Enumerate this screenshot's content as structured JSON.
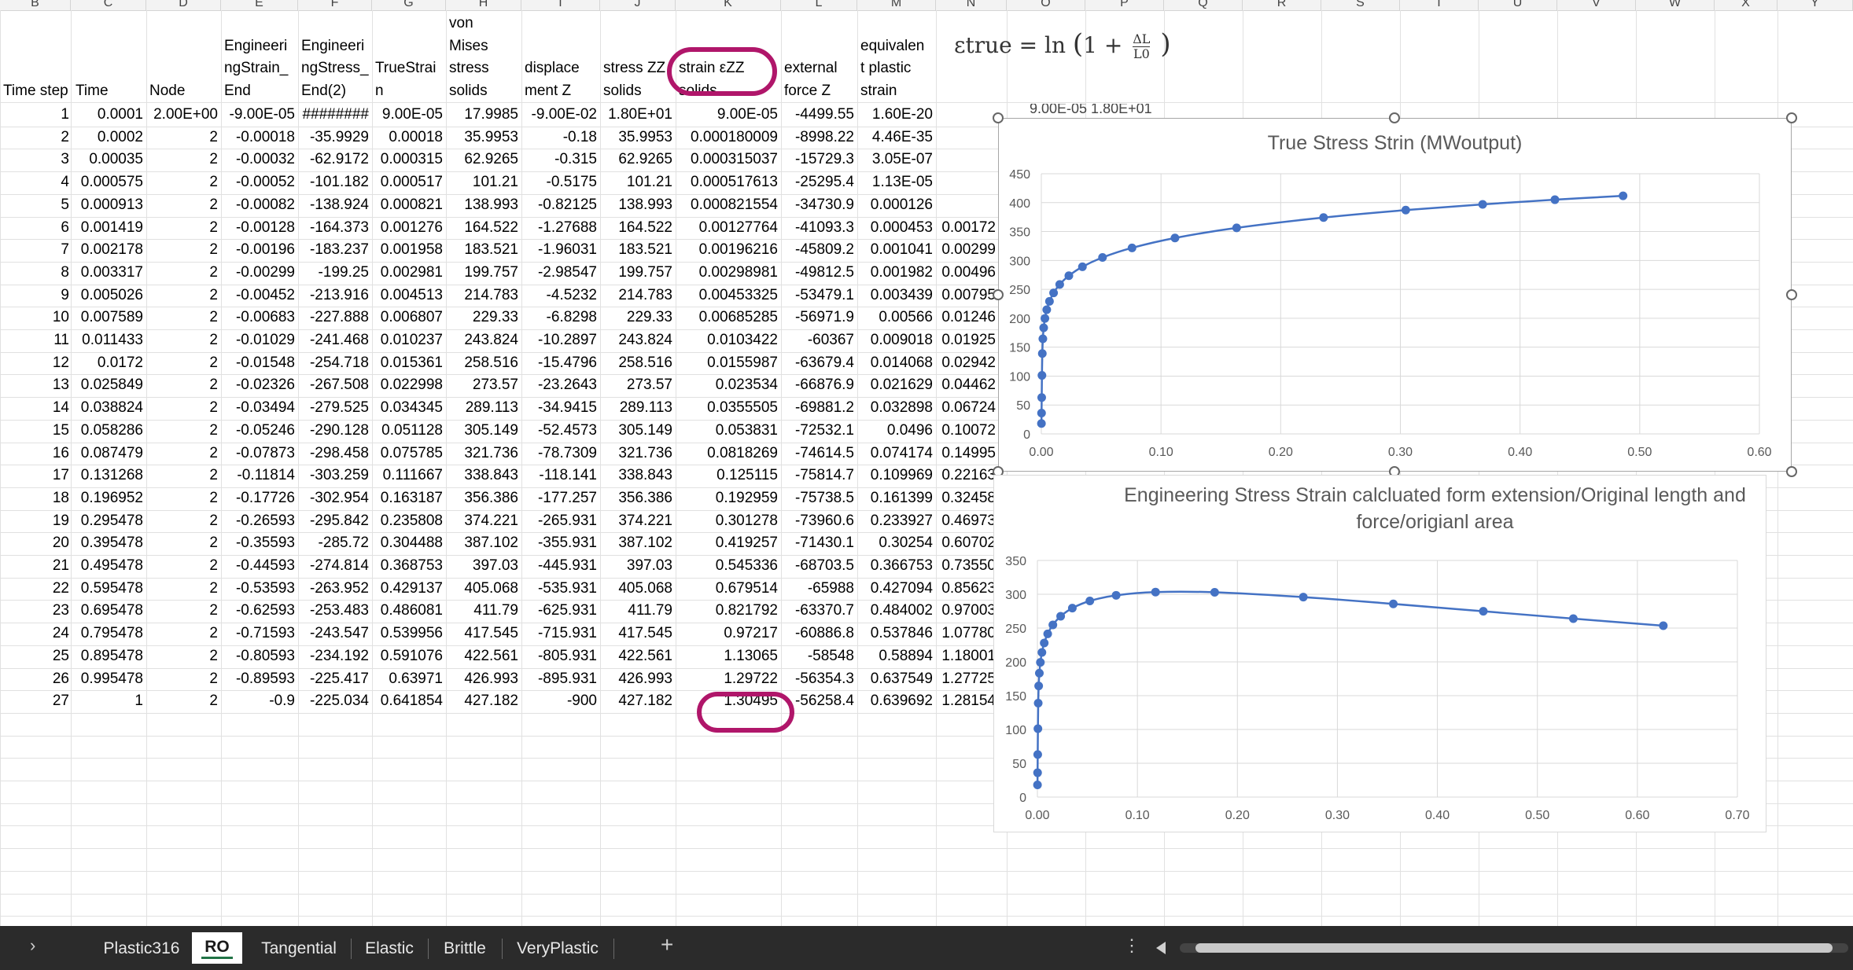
{
  "column_letters": [
    "B",
    "C",
    "D",
    "E",
    "F",
    "G",
    "H",
    "I",
    "J",
    "K",
    "L",
    "M",
    "N",
    "O",
    "P",
    "Q",
    "R",
    "S",
    "T",
    "U",
    "V",
    "W",
    "X",
    "Y"
  ],
  "headers": [
    "Time step",
    "Time",
    "Node",
    "Engineeri\nngStrain_\nEnd",
    "Engineeri\nngStress_\nEnd(2)",
    "TrueStrai\nn",
    "von\nMises\nstress\nsolids",
    "displace\nment Z",
    "stress ZZ\nsolids",
    "strain εZZ\nsolids",
    "external\nforce Z",
    "equivalen\nt plastic\nstrain"
  ],
  "rows": [
    [
      "1",
      "0.0001",
      "2.00E+00",
      "-9.00E-05",
      "########",
      "9.00E-05",
      "17.9985",
      "-9.00E-02",
      "1.80E+01",
      "9.00E-05",
      "-4499.55",
      "1.60E-20",
      ""
    ],
    [
      "2",
      "0.0002",
      "2",
      "-0.00018",
      "-35.9929",
      "0.00018",
      "35.9953",
      "-0.18",
      "35.9953",
      "0.000180009",
      "-8998.22",
      "4.46E-35",
      ""
    ],
    [
      "3",
      "0.00035",
      "2",
      "-0.00032",
      "-62.9172",
      "0.000315",
      "62.9265",
      "-0.315",
      "62.9265",
      "0.000315037",
      "-15729.3",
      "3.05E-07",
      ""
    ],
    [
      "4",
      "0.000575",
      "2",
      "-0.00052",
      "-101.182",
      "0.000517",
      "101.21",
      "-0.5175",
      "101.21",
      "0.000517613",
      "-25295.4",
      "1.13E-05",
      ""
    ],
    [
      "5",
      "0.000913",
      "2",
      "-0.00082",
      "-138.924",
      "0.000821",
      "138.993",
      "-0.82125",
      "138.993",
      "0.000821554",
      "-34730.9",
      "0.000126",
      ""
    ],
    [
      "6",
      "0.001419",
      "2",
      "-0.00128",
      "-164.373",
      "0.001276",
      "164.522",
      "-1.27688",
      "164.522",
      "0.00127764",
      "-41093.3",
      "0.000453",
      "0.00172"
    ],
    [
      "7",
      "0.002178",
      "2",
      "-0.00196",
      "-183.237",
      "0.001958",
      "183.521",
      "-1.96031",
      "183.521",
      "0.00196216",
      "-45809.2",
      "0.001041",
      "0.00299"
    ],
    [
      "8",
      "0.003317",
      "2",
      "-0.00299",
      "-199.25",
      "0.002981",
      "199.757",
      "-2.98547",
      "199.757",
      "0.00298981",
      "-49812.5",
      "0.001982",
      "0.00496"
    ],
    [
      "9",
      "0.005026",
      "2",
      "-0.00452",
      "-213.916",
      "0.004513",
      "214.783",
      "-4.5232",
      "214.783",
      "0.00453325",
      "-53479.1",
      "0.003439",
      "0.00795"
    ],
    [
      "10",
      "0.007589",
      "2",
      "-0.00683",
      "-227.888",
      "0.006807",
      "229.33",
      "-6.8298",
      "229.33",
      "0.00685285",
      "-56971.9",
      "0.00566",
      "0.01246"
    ],
    [
      "11",
      "0.011433",
      "2",
      "-0.01029",
      "-241.468",
      "0.010237",
      "243.824",
      "-10.2897",
      "243.824",
      "0.0103422",
      "-60367",
      "0.009018",
      "0.01925"
    ],
    [
      "12",
      "0.0172",
      "2",
      "-0.01548",
      "-254.718",
      "0.015361",
      "258.516",
      "-15.4796",
      "258.516",
      "0.0155987",
      "-63679.4",
      "0.014068",
      "0.02942"
    ],
    [
      "13",
      "0.025849",
      "2",
      "-0.02326",
      "-267.508",
      "0.022998",
      "273.57",
      "-23.2643",
      "273.57",
      "0.023534",
      "-66876.9",
      "0.021629",
      "0.04462"
    ],
    [
      "14",
      "0.038824",
      "2",
      "-0.03494",
      "-279.525",
      "0.034345",
      "289.113",
      "-34.9415",
      "289.113",
      "0.0355505",
      "-69881.2",
      "0.032898",
      "0.06724"
    ],
    [
      "15",
      "0.058286",
      "2",
      "-0.05246",
      "-290.128",
      "0.051128",
      "305.149",
      "-52.4573",
      "305.149",
      "0.053831",
      "-72532.1",
      "0.0496",
      "0.10072"
    ],
    [
      "16",
      "0.087479",
      "2",
      "-0.07873",
      "-298.458",
      "0.075785",
      "321.736",
      "-78.7309",
      "321.736",
      "0.0818269",
      "-74614.5",
      "0.074174",
      "0.14995"
    ],
    [
      "17",
      "0.131268",
      "2",
      "-0.11814",
      "-303.259",
      "0.111667",
      "338.843",
      "-118.141",
      "338.843",
      "0.125115",
      "-75814.7",
      "0.109969",
      "0.22163"
    ],
    [
      "18",
      "0.196952",
      "2",
      "-0.17726",
      "-302.954",
      "0.163187",
      "356.386",
      "-177.257",
      "356.386",
      "0.192959",
      "-75738.5",
      "0.161399",
      "0.32458"
    ],
    [
      "19",
      "0.295478",
      "2",
      "-0.26593",
      "-295.842",
      "0.235808",
      "374.221",
      "-265.931",
      "374.221",
      "0.301278",
      "-73960.6",
      "0.233927",
      "0.46973"
    ],
    [
      "20",
      "0.395478",
      "2",
      "-0.35593",
      "-285.72",
      "0.304488",
      "387.102",
      "-355.931",
      "387.102",
      "0.419257",
      "-71430.1",
      "0.30254",
      "0.60702"
    ],
    [
      "21",
      "0.495478",
      "2",
      "-0.44593",
      "-274.814",
      "0.368753",
      "397.03",
      "-445.931",
      "397.03",
      "0.545336",
      "-68703.5",
      "0.366753",
      "0.73550"
    ],
    [
      "22",
      "0.595478",
      "2",
      "-0.53593",
      "-263.952",
      "0.429137",
      "405.068",
      "-535.931",
      "405.068",
      "0.679514",
      "-65988",
      "0.427094",
      "0.85623"
    ],
    [
      "23",
      "0.695478",
      "2",
      "-0.62593",
      "-253.483",
      "0.486081",
      "411.79",
      "-625.931",
      "411.79",
      "0.821792",
      "-63370.7",
      "0.484002",
      "0.97003"
    ],
    [
      "24",
      "0.795478",
      "2",
      "-0.71593",
      "-243.547",
      "0.539956",
      "417.545",
      "-715.931",
      "417.545",
      "0.97217",
      "-60886.8",
      "0.537846",
      "1.07780"
    ],
    [
      "25",
      "0.895478",
      "2",
      "-0.80593",
      "-234.192",
      "0.591076",
      "422.561",
      "-805.931",
      "422.561",
      "1.13065",
      "-58548",
      "0.58894",
      "1.18001"
    ],
    [
      "26",
      "0.995478",
      "2",
      "-0.89593",
      "-225.417",
      "0.63971",
      "426.993",
      "-895.931",
      "426.993",
      "1.29722",
      "-56354.3",
      "0.637549",
      "1.27725"
    ],
    [
      "27",
      "1",
      "2",
      "-0.9",
      "-225.034",
      "0.641854",
      "427.182",
      "-900",
      "427.182",
      "1.30495",
      "-56258.4",
      "0.639692",
      "1.28154"
    ]
  ],
  "formula": {
    "lhs": "εtrue = ln",
    "numerator": "ΔL",
    "denominator": "L0"
  },
  "hidden_row_fragment": "9.00E-05  1.80E+01",
  "chart_data": [
    {
      "type": "scatter",
      "title": "True Stress Strin (MWoutput)",
      "xlabel": "",
      "ylabel": "",
      "xlim": [
        0,
        0.6
      ],
      "ylim": [
        0,
        450
      ],
      "xticks": [
        "0.00",
        "0.10",
        "0.20",
        "0.30",
        "0.40",
        "0.50",
        "0.60"
      ],
      "yticks": [
        "0",
        "50",
        "100",
        "150",
        "200",
        "250",
        "300",
        "350",
        "400",
        "450"
      ],
      "grid": true,
      "legend": "none",
      "color": "#4472c4",
      "x": [
        9e-05,
        0.00018,
        0.000315,
        0.000517,
        0.000821,
        0.001276,
        0.001958,
        0.002981,
        0.004513,
        0.006807,
        0.010237,
        0.015361,
        0.022998,
        0.034345,
        0.051128,
        0.075785,
        0.111667,
        0.163187,
        0.235808,
        0.304488,
        0.368753,
        0.429137,
        0.486081
      ],
      "y": [
        17.9985,
        35.9953,
        62.9265,
        101.21,
        138.993,
        164.522,
        183.521,
        199.757,
        214.783,
        229.33,
        243.824,
        258.516,
        273.57,
        289.113,
        305.149,
        321.736,
        338.843,
        356.386,
        374.221,
        387.102,
        397.03,
        405.068,
        411.79
      ]
    },
    {
      "type": "scatter",
      "title": "Engineering Stress Strain calcluated form extension/Original length and force/origianl area",
      "xlabel": "",
      "ylabel": "",
      "xlim": [
        0,
        0.7
      ],
      "ylim": [
        0,
        350
      ],
      "xticks": [
        "0.00",
        "0.10",
        "0.20",
        "0.30",
        "0.40",
        "0.50",
        "0.60",
        "0.70"
      ],
      "yticks": [
        "0",
        "50",
        "100",
        "150",
        "200",
        "250",
        "300",
        "350"
      ],
      "grid": true,
      "legend": "none",
      "color": "#4472c4",
      "x": [
        9e-05,
        0.00018,
        0.00032,
        0.00052,
        0.00082,
        0.00128,
        0.00196,
        0.00299,
        0.00452,
        0.00683,
        0.01029,
        0.01548,
        0.02326,
        0.03494,
        0.05246,
        0.07873,
        0.11814,
        0.17726,
        0.26593,
        0.35593,
        0.44593,
        0.53593,
        0.62593
      ],
      "y": [
        18,
        35.99,
        62.92,
        101.18,
        138.92,
        164.37,
        183.24,
        199.25,
        213.92,
        227.89,
        241.47,
        254.72,
        267.51,
        279.53,
        290.13,
        298.46,
        303.26,
        302.95,
        295.84,
        285.72,
        274.81,
        263.95,
        253.48
      ]
    }
  ],
  "tabs": [
    {
      "label": "Plastic316",
      "active": false
    },
    {
      "label": "RO",
      "active": true
    },
    {
      "label": "Tangential",
      "active": false
    },
    {
      "label": "Elastic",
      "active": false
    },
    {
      "label": "Brittle",
      "active": false
    },
    {
      "label": "VeryPlastic",
      "active": false
    }
  ],
  "add_sheet_label": "+",
  "scroll_left_label": "›",
  "more_label": "⋮",
  "colors": {
    "accent": "#217346",
    "series": "#4472c4",
    "annotation": "#b0166a",
    "tabbar": "#2b2b2b"
  }
}
